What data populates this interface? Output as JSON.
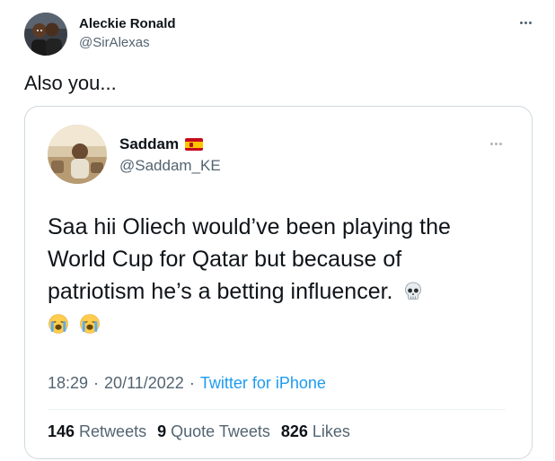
{
  "tweet": {
    "author_name": "Aleckie Ronald",
    "author_handle": "@SirAlexas",
    "text": "Also you...",
    "more_icon": "more-horizontal-icon"
  },
  "quoted_tweet": {
    "author_name": "Saddam",
    "author_flag": "spain-flag",
    "author_handle": "@Saddam_KE",
    "text_lines": [
      "Saa hii Oliech would’ve been playing the",
      "World Cup for Qatar but because of",
      "patriotism he’s a betting influencer."
    ],
    "emojis": [
      "skull-emoji",
      "loudly-crying-face-emoji",
      "loudly-crying-face-emoji"
    ],
    "time": "18:29",
    "date": "20/11/2022",
    "separator": "·",
    "source": "Twitter for iPhone",
    "stats": {
      "retweets_count": "146",
      "retweets_label": "Retweets",
      "quotes_count": "9",
      "quotes_label": "Quote Tweets",
      "likes_count": "826",
      "likes_label": "Likes"
    }
  },
  "colors": {
    "text_primary": "#0f1419",
    "text_secondary": "#536471",
    "link": "#1d9bf0",
    "border": "#cfd9de"
  }
}
